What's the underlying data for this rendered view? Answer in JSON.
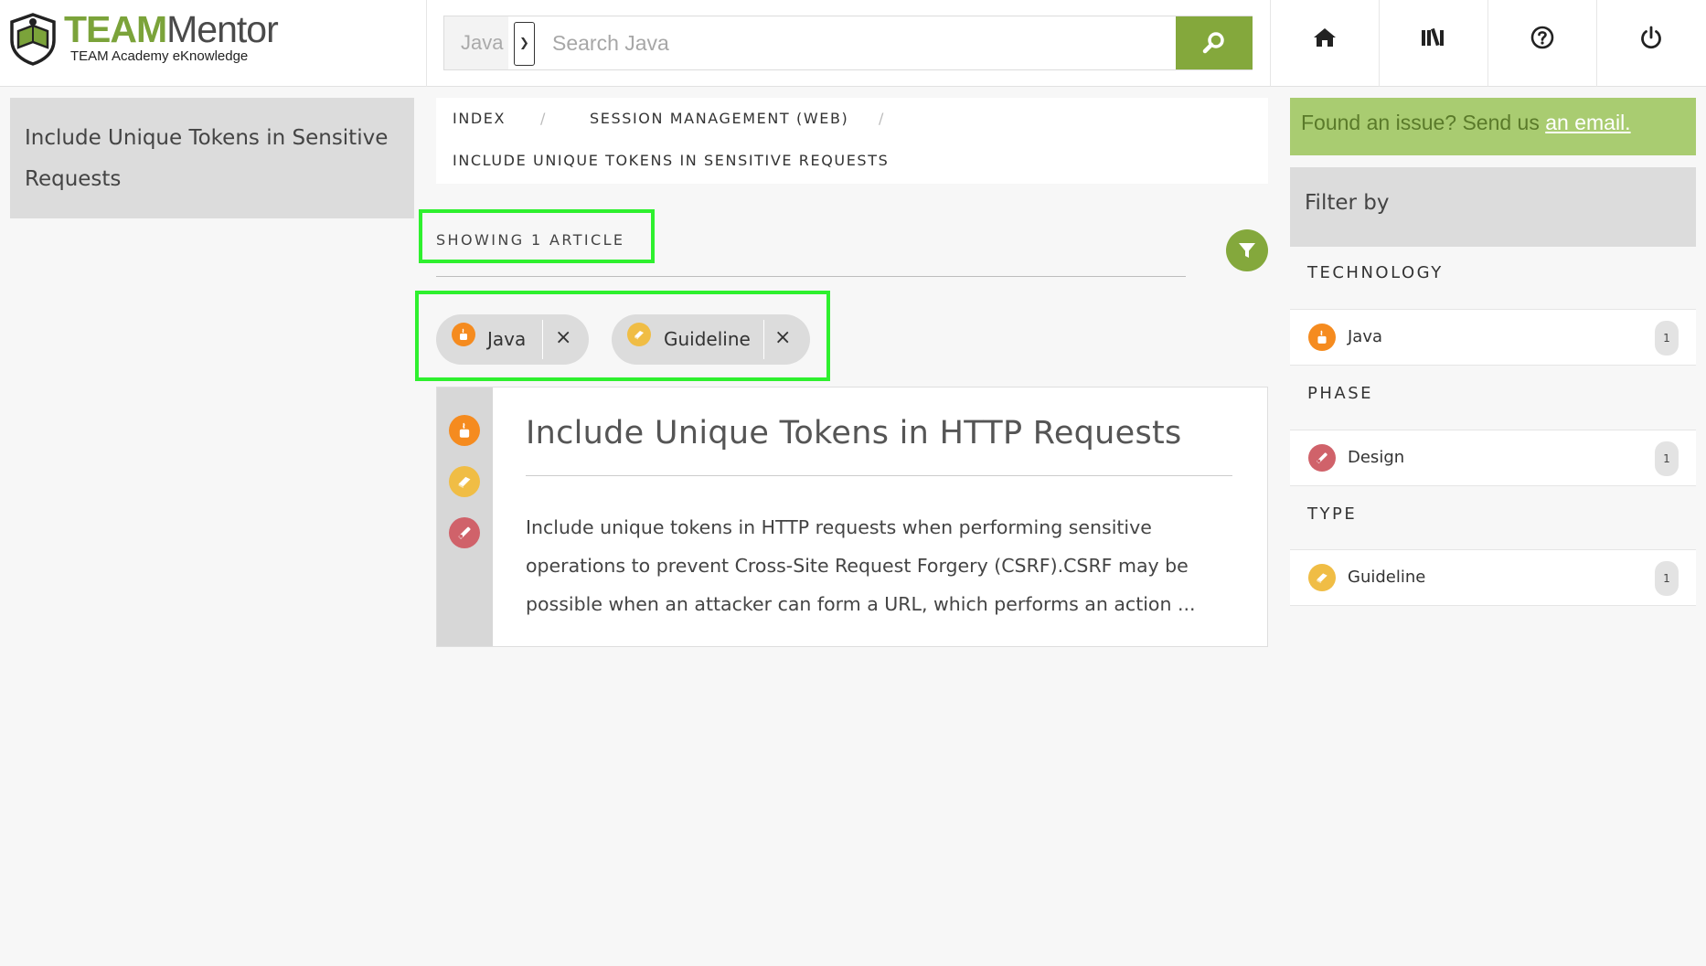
{
  "brand": {
    "title_part1": "TEAM",
    "title_part2": "Mentor",
    "subtitle": "TEAM Academy eKnowledge"
  },
  "search": {
    "technology_selected": "Java",
    "placeholder": "Search Java",
    "value": ""
  },
  "nav": {
    "items": [
      {
        "icon": "home-icon"
      },
      {
        "icon": "library-icon"
      },
      {
        "icon": "help-icon"
      },
      {
        "icon": "power-icon"
      }
    ]
  },
  "left_panel": {
    "line1": "Include Unique Tokens in Sensitive",
    "line2": "Requests"
  },
  "breadcrumb": {
    "items": [
      "INDEX",
      "SESSION MANAGEMENT (WEB)",
      "INCLUDE UNIQUE TOKENS IN SENSITIVE REQUESTS"
    ],
    "separator": "/"
  },
  "results": {
    "showing": "SHOWING 1 ARTICLE"
  },
  "active_filters": [
    {
      "label": "Java",
      "icon": "java-icon",
      "remove": "×"
    },
    {
      "label": "Guideline",
      "icon": "guideline-icon",
      "remove": "×"
    }
  ],
  "article": {
    "title": "Include Unique Tokens in HTTP Requests",
    "lines": [
      "Include unique tokens in HTTP requests when performing sensitive",
      "operations to prevent Cross-Site Request Forgery (CSRF).CSRF may be",
      "possible when an attacker can form a URL, which performs an action ..."
    ],
    "icons": [
      "java-icon",
      "guideline-icon",
      "design-icon"
    ]
  },
  "issue": {
    "text": "Found an issue? Send us ",
    "link": "an email."
  },
  "filter_panel": {
    "title": "Filter by",
    "sections": [
      {
        "label": "TECHNOLOGY",
        "facet": {
          "label": "Java",
          "count": "1",
          "icon": "java-icon"
        }
      },
      {
        "label": "PHASE",
        "facet": {
          "label": "Design",
          "count": "1",
          "icon": "design-icon"
        }
      },
      {
        "label": "TYPE",
        "facet": {
          "label": "Guideline",
          "count": "1",
          "icon": "guideline-icon"
        }
      }
    ]
  },
  "colors": {
    "accent": "#84a83c",
    "issue_bg": "#a9cc71",
    "java": "#f58b1f",
    "guideline": "#f0bd45",
    "design": "#d0626a",
    "highlight": "#2ef02e"
  }
}
